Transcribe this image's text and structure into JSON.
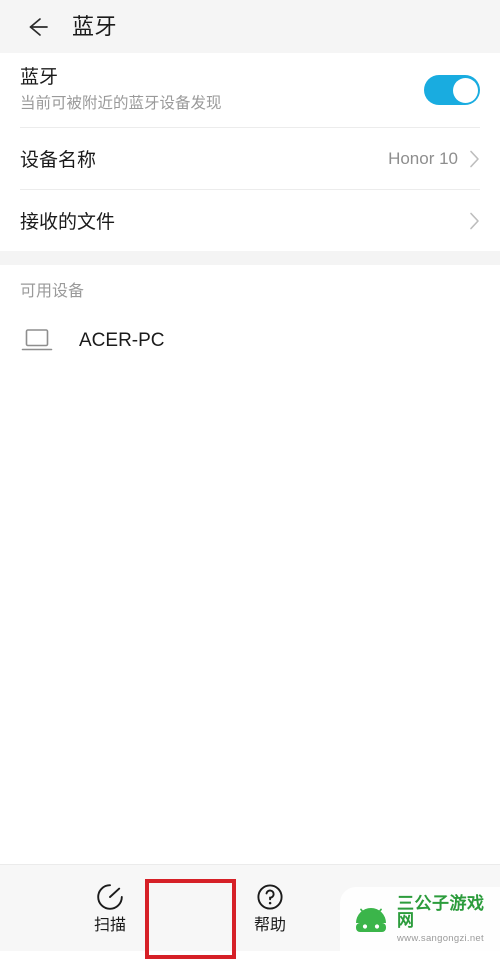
{
  "header": {
    "back_icon": "arrow-left-icon",
    "title": "蓝牙"
  },
  "bluetooth": {
    "title": "蓝牙",
    "subtitle": "当前可被附近的蓝牙设备发现",
    "toggle_on": true,
    "toggle_color": "#19ace0"
  },
  "settings": [
    {
      "label": "设备名称",
      "value": "Honor 10",
      "chevron": "chevron-right-icon"
    },
    {
      "label": "接收的文件",
      "value": "",
      "chevron": "chevron-right-icon"
    }
  ],
  "available_devices": {
    "section_label": "可用设备",
    "devices": [
      {
        "name": "ACER-PC",
        "icon": "laptop-icon"
      }
    ]
  },
  "bottom_bar": {
    "tabs": [
      {
        "label": "扫描",
        "icon": "scan-refresh-icon",
        "highlighted": true
      },
      {
        "label": "帮助",
        "icon": "question-circle-icon",
        "highlighted": false
      }
    ],
    "highlight_color": "#d62027"
  },
  "watermark": {
    "title": "三公子游戏网",
    "url": "www.sangongzi.net",
    "brand_color": "#2c9c3c"
  }
}
